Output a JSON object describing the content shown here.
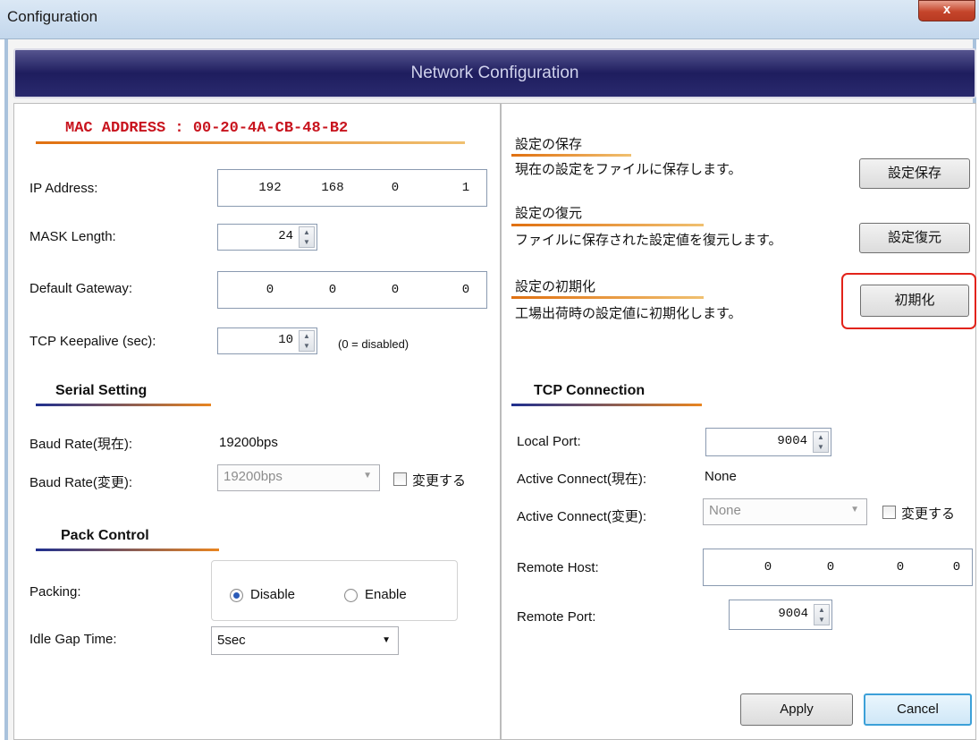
{
  "window": {
    "title": "Configuration",
    "close_label": "x"
  },
  "banner": {
    "title": "Network Configuration"
  },
  "left": {
    "mac_heading": "MAC ADDRESS : 00-20-4A-CB-48-B2",
    "ip_label": "IP Address:",
    "ip": [
      "192",
      "168",
      "0",
      "1"
    ],
    "mask_label": "MASK Length:",
    "mask_value": "24",
    "gateway_label": "Default Gateway:",
    "gateway": [
      "0",
      "0",
      "0",
      "0"
    ],
    "keepalive_label": "TCP Keepalive (sec):",
    "keepalive_value": "10",
    "keepalive_note": "(0 = disabled)",
    "serial_heading": "Serial Setting",
    "baud_current_label": "Baud Rate(現在):",
    "baud_current_value": "19200bps",
    "baud_change_label": "Baud Rate(変更):",
    "baud_change_value": "19200bps",
    "baud_change_check": "変更する",
    "pack_heading": "Pack Control",
    "packing_label": "Packing:",
    "packing_disable": "Disable",
    "packing_enable": "Enable",
    "packing_selected": "Disable",
    "idle_label": "Idle Gap Time:",
    "idle_value": "5sec"
  },
  "right": {
    "save_heading": "設定の保存",
    "save_desc": "現在の設定をファイルに保存します。",
    "save_button": "設定保存",
    "restore_heading": "設定の復元",
    "restore_desc": "ファイルに保存された設定値を復元します。",
    "restore_button": "設定復元",
    "init_heading": "設定の初期化",
    "init_desc": "工場出荷時の設定値に初期化します。",
    "init_button": "初期化",
    "tcp_heading": "TCP Connection",
    "local_port_label": "Local Port:",
    "local_port_value": "9004",
    "active_current_label": "Active Connect(現在):",
    "active_current_value": "None",
    "active_change_label": "Active Connect(変更):",
    "active_change_value": "None",
    "active_change_check": "変更する",
    "remote_host_label": "Remote Host:",
    "remote_host": [
      "0",
      "0",
      "0",
      "0"
    ],
    "remote_port_label": "Remote Port:",
    "remote_port_value": "9004"
  },
  "footer": {
    "apply": "Apply",
    "cancel": "Cancel"
  },
  "colors": {
    "highlight": "#e2231a",
    "mac_heading": "#c8141e",
    "banner": "#2a2a6e"
  }
}
